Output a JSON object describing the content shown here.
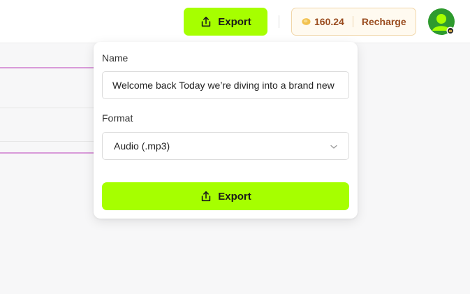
{
  "header": {
    "export_label": "Export",
    "credits_value": "160.24",
    "recharge_label": "Recharge"
  },
  "export_popover": {
    "name_label": "Name",
    "name_value": "Welcome back Today we’re diving into a brand new",
    "format_label": "Format",
    "format_value": "Audio (.mp3)",
    "export_button_label": "Export"
  },
  "colors": {
    "accent": "#a6ff00",
    "credits_text": "#9a4c1f",
    "avatar": "#2e9a2e"
  },
  "icons": {
    "export": "upload-share-icon",
    "credits": "coin-icon",
    "format_dropdown": "chevron-down-icon",
    "avatar": "user-avatar-icon"
  }
}
